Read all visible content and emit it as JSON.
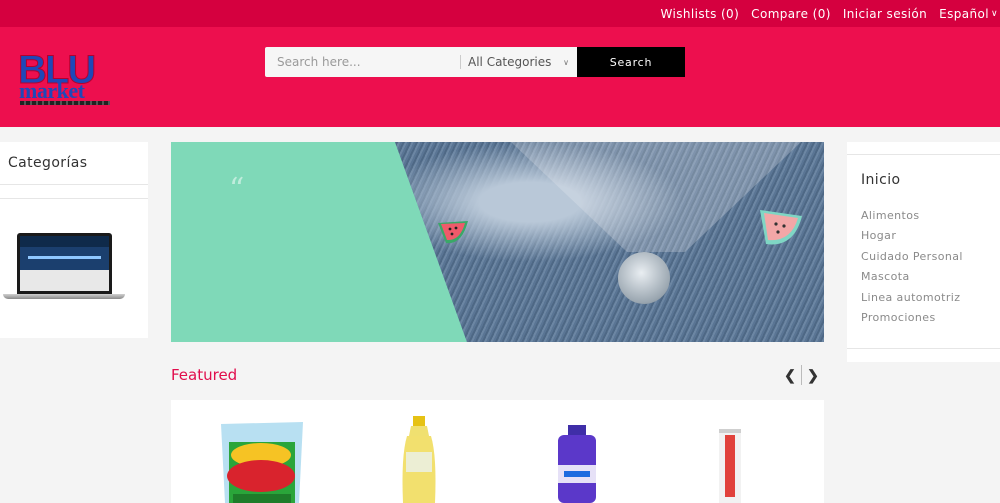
{
  "topbar": {
    "wishlists": "Wishlists (0)",
    "compare": "Compare (0)",
    "login": "Iniciar sesión",
    "language": "Español"
  },
  "logo": {
    "line1": "BLU",
    "line2": "market"
  },
  "search": {
    "placeholder": "Search here...",
    "category": "All Categories",
    "button": "Search"
  },
  "left_panel": {
    "title": "Categorías"
  },
  "featured": {
    "title": "Featured"
  },
  "right_panel": {
    "title": "Inicio",
    "items": [
      "Alimentos",
      "Hogar",
      "Cuidado Personal",
      "Mascota",
      "Linea automotriz",
      "Promociones"
    ]
  },
  "colors": {
    "topbar": "#d5003f",
    "header": "#ed0f4e",
    "accent": "#e10d4c",
    "banner_mint": "#7fd9b8"
  }
}
